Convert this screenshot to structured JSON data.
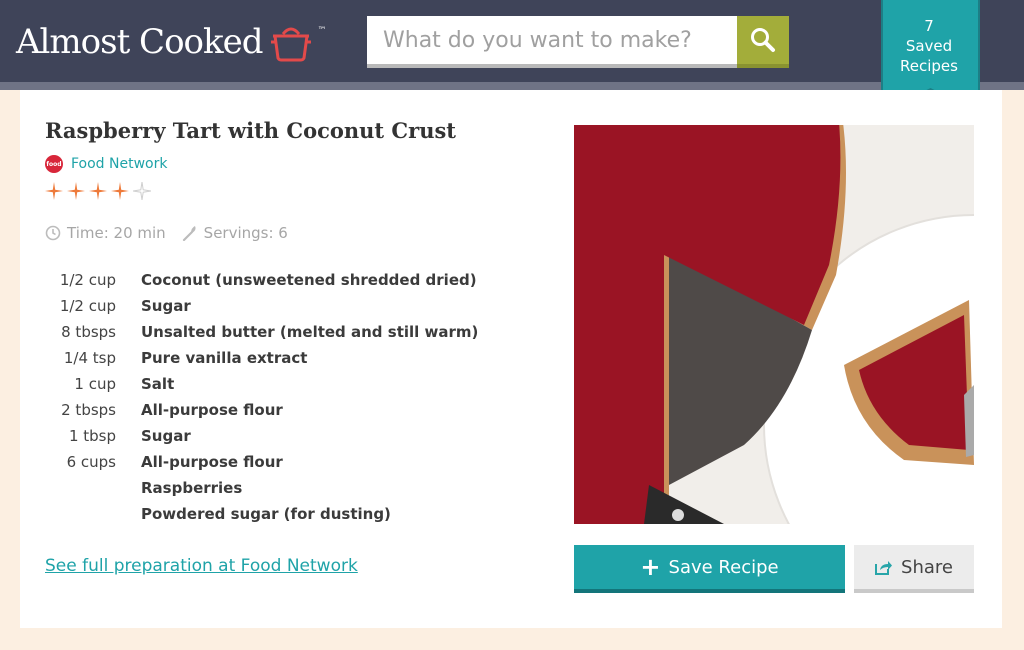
{
  "header": {
    "logo_text": "Almost Cooked",
    "logo_tm": "™",
    "search_placeholder": "What do you want to make?",
    "saved_count": "7",
    "saved_label_1": "Saved",
    "saved_label_2": "Recipes"
  },
  "recipe": {
    "title": "Raspberry Tart with Coconut Crust",
    "source": "Food Network",
    "source_logo_text": "food",
    "rating": 4,
    "rating_max": 5,
    "time": "Time: 20 min",
    "servings": "Servings: 6",
    "ingredients": [
      {
        "qty": "1/2 cup",
        "name": "Coconut (unsweetened shredded dried)"
      },
      {
        "qty": "1/2 cup",
        "name": "Sugar"
      },
      {
        "qty": "8 tbsps",
        "name": "Unsalted butter (melted and still warm)"
      },
      {
        "qty": "1/4 tsp",
        "name": "Pure vanilla extract"
      },
      {
        "qty": "1 cup",
        "name": "Salt"
      },
      {
        "qty": "2 tbsps",
        "name": "All-purpose flour"
      },
      {
        "qty": "1 tbsp",
        "name": "Sugar"
      },
      {
        "qty": "6 cups",
        "name": "All-purpose flour"
      },
      {
        "qty": "",
        "name": "Raspberries"
      },
      {
        "qty": "",
        "name": "Powdered sugar (for dusting)"
      }
    ],
    "full_prep_link": "See full preparation at Food Network",
    "save_label": "Save Recipe",
    "share_label": "Share"
  },
  "colors": {
    "header_bg": "#3f4459",
    "accent_teal": "#1fa3a8",
    "search_btn": "#a3ad3a",
    "star": "#ee7a3a",
    "page_bg": "#fcefe1"
  }
}
